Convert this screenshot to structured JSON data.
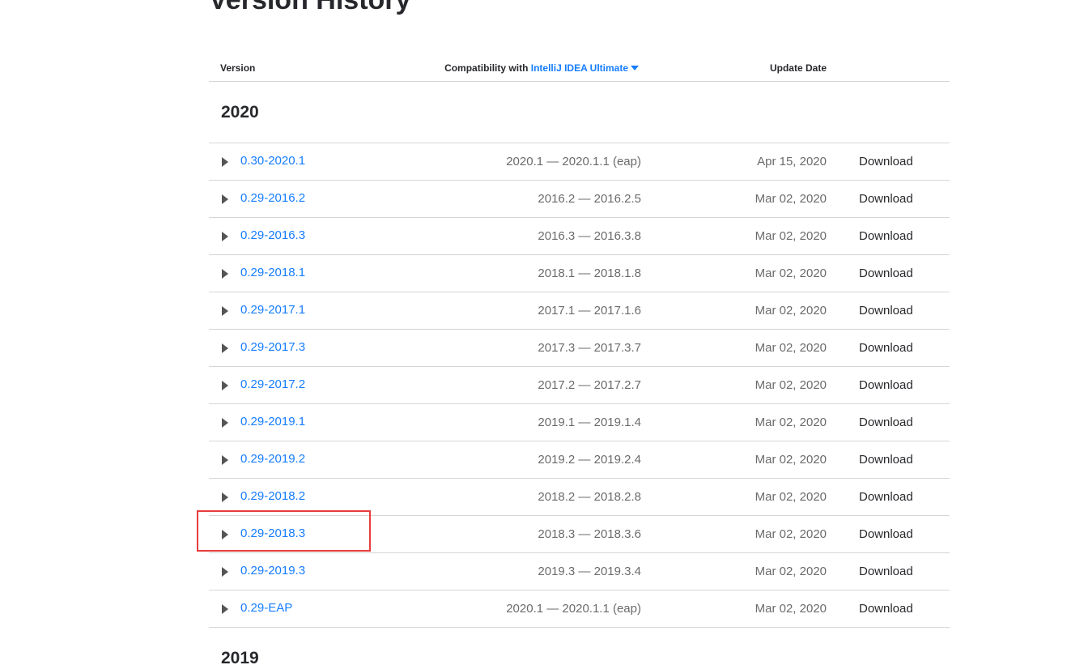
{
  "page": {
    "title": "Version History"
  },
  "table": {
    "headers": {
      "version": "Version",
      "compatibility_prefix": "Compatibility with",
      "compatibility_product": "IntelliJ IDEA Ultimate",
      "update_date": "Update Date"
    },
    "groups": [
      {
        "year": "2020",
        "rows": [
          {
            "version": "0.30-2020.1",
            "compatibility": "2020.1 — 2020.1.1 (eap)",
            "date": "Apr 15, 2020",
            "download": "Download"
          },
          {
            "version": "0.29-2016.2",
            "compatibility": "2016.2 — 2016.2.5",
            "date": "Mar 02, 2020",
            "download": "Download"
          },
          {
            "version": "0.29-2016.3",
            "compatibility": "2016.3 — 2016.3.8",
            "date": "Mar 02, 2020",
            "download": "Download"
          },
          {
            "version": "0.29-2018.1",
            "compatibility": "2018.1 — 2018.1.8",
            "date": "Mar 02, 2020",
            "download": "Download"
          },
          {
            "version": "0.29-2017.1",
            "compatibility": "2017.1 — 2017.1.6",
            "date": "Mar 02, 2020",
            "download": "Download"
          },
          {
            "version": "0.29-2017.3",
            "compatibility": "2017.3 — 2017.3.7",
            "date": "Mar 02, 2020",
            "download": "Download"
          },
          {
            "version": "0.29-2017.2",
            "compatibility": "2017.2 — 2017.2.7",
            "date": "Mar 02, 2020",
            "download": "Download"
          },
          {
            "version": "0.29-2019.1",
            "compatibility": "2019.1 — 2019.1.4",
            "date": "Mar 02, 2020",
            "download": "Download"
          },
          {
            "version": "0.29-2019.2",
            "compatibility": "2019.2 — 2019.2.4",
            "date": "Mar 02, 2020",
            "download": "Download"
          },
          {
            "version": "0.29-2018.2",
            "compatibility": "2018.2 — 2018.2.8",
            "date": "Mar 02, 2020",
            "download": "Download"
          },
          {
            "version": "0.29-2018.3",
            "compatibility": "2018.3 — 2018.3.6",
            "date": "Mar 02, 2020",
            "download": "Download"
          },
          {
            "version": "0.29-2019.3",
            "compatibility": "2019.3 — 2019.3.4",
            "date": "Mar 02, 2020",
            "download": "Download"
          },
          {
            "version": "0.29-EAP",
            "compatibility": "2020.1 — 2020.1.1 (eap)",
            "date": "Mar 02, 2020",
            "download": "Download"
          }
        ]
      },
      {
        "year": "2019",
        "rows": []
      }
    ]
  },
  "colors": {
    "link": "#167dff",
    "highlight_border": "#e83d3d",
    "divider": "#d6d6d6"
  },
  "icons": {
    "row_toggle": "triangle-right-icon",
    "product_dropdown": "caret-down-icon"
  }
}
